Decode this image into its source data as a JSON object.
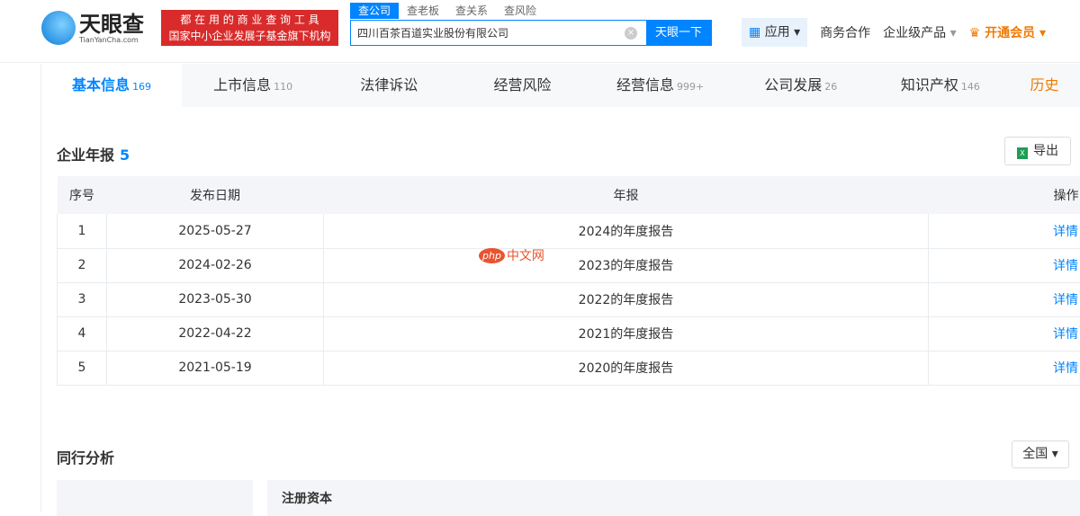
{
  "header": {
    "logo_cn": "天眼查",
    "logo_en": "TianYanCha.com",
    "slogan_1": "都 在 用 的 商 业 查 询 工 具",
    "slogan_2": "国家中小企业发展子基金旗下机构",
    "search_tabs": [
      "查公司",
      "查老板",
      "查关系",
      "查风险"
    ],
    "search_value": "四川百茶百道实业股份有限公司",
    "search_button": "天眼一下",
    "nav": {
      "apps": "应用",
      "business": "商务合作",
      "enterprise": "企业级产品",
      "vip": "开通会员"
    }
  },
  "tabs": [
    {
      "label": "基本信息",
      "count": "169"
    },
    {
      "label": "上市信息",
      "count": "110"
    },
    {
      "label": "法律诉讼",
      "count": ""
    },
    {
      "label": "经营风险",
      "count": ""
    },
    {
      "label": "经营信息",
      "count": "999+"
    },
    {
      "label": "公司发展",
      "count": "26"
    },
    {
      "label": "知识产权",
      "count": "146"
    },
    {
      "label": "历史",
      "count": ""
    }
  ],
  "annual": {
    "title": "企业年报",
    "count": "5",
    "export": "导出",
    "columns": [
      "序号",
      "发布日期",
      "年报",
      "操作"
    ],
    "rows": [
      [
        "1",
        "2025-05-27",
        "2024的年度报告",
        "详情"
      ],
      [
        "2",
        "2024-02-26",
        "2023的年度报告",
        "详情"
      ],
      [
        "3",
        "2023-05-30",
        "2022的年度报告",
        "详情"
      ],
      [
        "4",
        "2022-04-22",
        "2021的年度报告",
        "详情"
      ],
      [
        "5",
        "2021-05-19",
        "2020的年度报告",
        "详情"
      ]
    ]
  },
  "peer": {
    "title": "同行分析",
    "region": "全国",
    "col_label": "注册资本"
  },
  "watermark": {
    "badge": "php",
    "text": "中文网"
  }
}
